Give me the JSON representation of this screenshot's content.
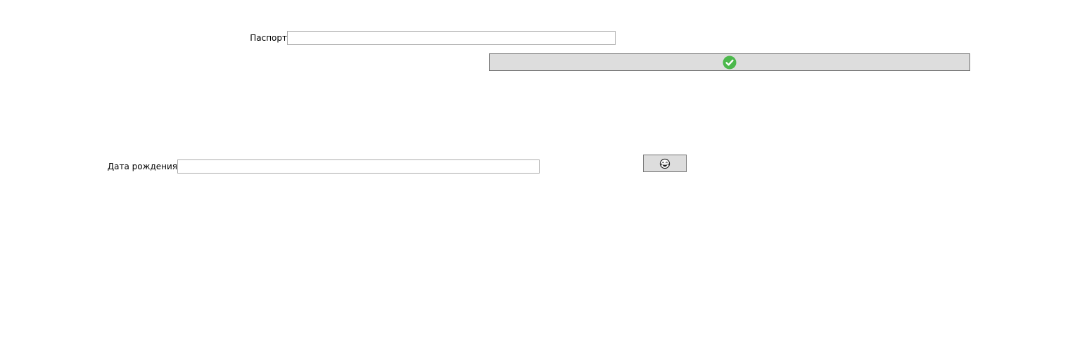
{
  "form": {
    "passport": {
      "label": "Паспорт",
      "value": "",
      "placeholder": ""
    },
    "confirm_button": {
      "icon": "check-circle-icon",
      "icon_color": "#4cb84c"
    },
    "birth_date": {
      "label": "Дата рождения",
      "value": "",
      "placeholder": ""
    },
    "emoji_button": {
      "icon": "crying-laughing-face-icon"
    }
  },
  "colors": {
    "background": "#ffffff",
    "button_face": "#dddddd",
    "button_border": "#707070",
    "input_border": "#acacac"
  }
}
